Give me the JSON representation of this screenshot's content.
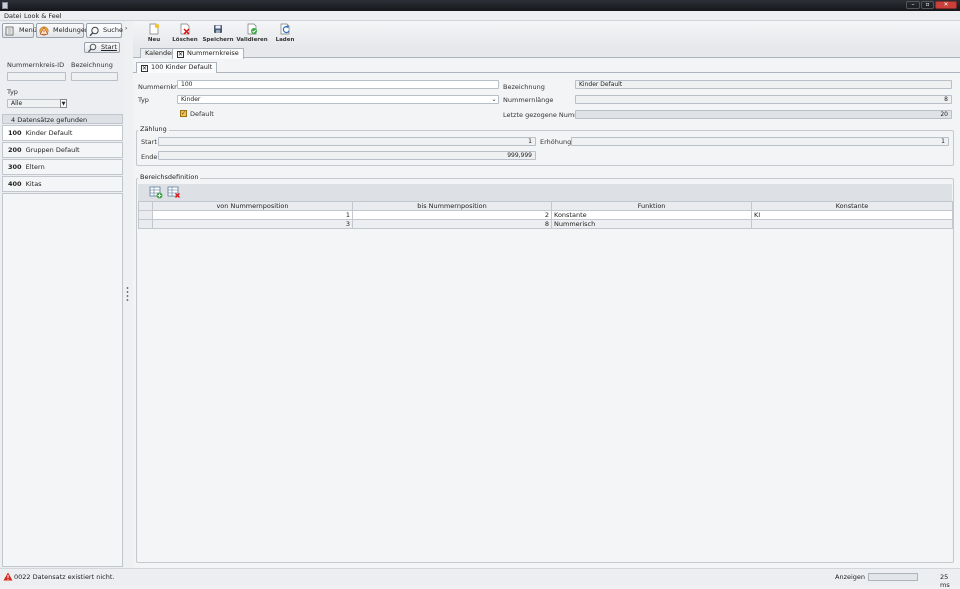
{
  "menu": {
    "items": [
      "Datei",
      "Look & Feel"
    ]
  },
  "nav": {
    "menu_label": "Menü",
    "messages_label": "Meldungen",
    "search_label": "Suche"
  },
  "search": {
    "start_label": "Start",
    "id_label": "Nummernkreis-ID",
    "name_label": "Bezeichnung",
    "type_label": "Typ",
    "type_value": "Alle",
    "results_text": "4 Datensätze gefunden",
    "results": [
      {
        "id": "100",
        "name": "Kinder Default"
      },
      {
        "id": "200",
        "name": "Gruppen Default"
      },
      {
        "id": "300",
        "name": "Eltern"
      },
      {
        "id": "400",
        "name": "Kitas"
      }
    ]
  },
  "toolbar": {
    "buttons": [
      "Neu",
      "Löschen",
      "Speichern",
      "Validieren",
      "Laden"
    ]
  },
  "tabs": {
    "main": [
      "Kalender",
      "Nummernkreise"
    ],
    "record": "100 Kinder Default"
  },
  "form": {
    "nummernkreis_label": "Nummernkreis",
    "nummernkreis_value": "100",
    "typ_label": "Typ",
    "typ_value": "Kinder",
    "default_label": "Default",
    "bezeichnung_label": "Bezeichnung",
    "bezeichnung_value": "Kinder Default",
    "laenge_label": "Nummernlänge",
    "laenge_value": "8",
    "letzte_label": "Letzte gezogene Nummer",
    "letzte_value": "20"
  },
  "zaehlung": {
    "title": "Zählung",
    "start_label": "Start",
    "start_value": "1",
    "erhoehung_label": "Erhöhung",
    "erhoehung_value": "1",
    "ende_label": "Ende",
    "ende_value": "999,999"
  },
  "bereich": {
    "title": "Bereichsdefinition",
    "headers": [
      "von Nummernposition",
      "bis Nummernposition",
      "Funktion",
      "Konstante"
    ],
    "rows": [
      [
        "1",
        "2",
        "Konstante",
        "KI"
      ],
      [
        "3",
        "8",
        "Nummerisch",
        ""
      ]
    ]
  },
  "status": {
    "message": "0022 Datensatz existiert nicht.",
    "anzeigen_label": "Anzeigen",
    "time": "25 ms"
  },
  "colors": {
    "titlebar": "#1d1f24",
    "accent": "#d9a521",
    "error": "#d7261c"
  }
}
